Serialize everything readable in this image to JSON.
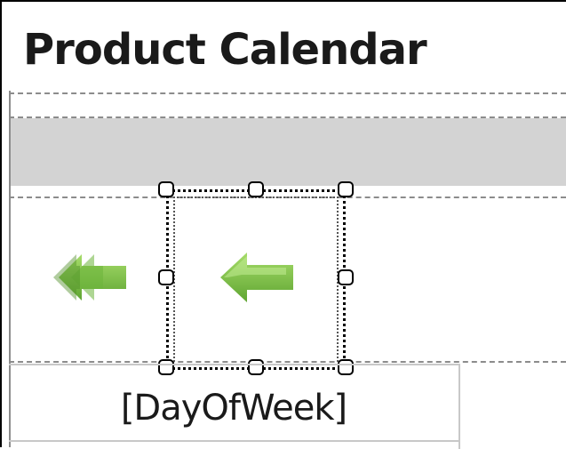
{
  "report": {
    "title": "Product Calendar",
    "day_of_week_field": "[DayOfWeek]"
  },
  "navigation": {
    "first_icon": "double-left-arrow",
    "previous_icon": "left-arrow"
  },
  "colors": {
    "arrow_green": "#7fc14a",
    "arrow_dark": "#5a9a2f",
    "band_gray": "#d3d3d3",
    "dash_gray": "#8c8c8c"
  }
}
